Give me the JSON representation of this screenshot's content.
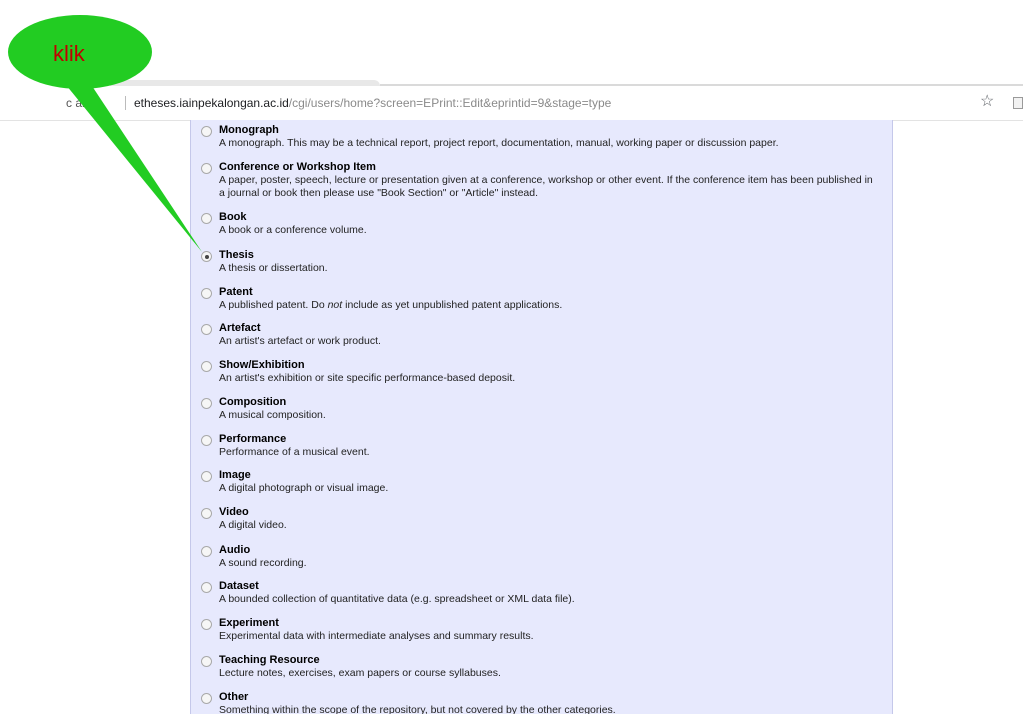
{
  "browser": {
    "url_prefix": "c ar",
    "url_host": "etheses.iainpekalongan.ac.id",
    "url_path": "/cgi/users/home?screen=EPrint::Edit&eprintid=9&stage=type"
  },
  "annotation": {
    "label": "klik",
    "color": "#22cc22"
  },
  "options": [
    {
      "title": "Monograph",
      "desc": "A monograph. This may be a technical report, project report, documentation, manual, working paper or discussion paper.",
      "checked": false
    },
    {
      "title": "Conference or Workshop Item",
      "desc": "A paper, poster, speech, lecture or presentation given at a conference, workshop or other event. If the conference item has been published in a journal or book then please use \"Book Section\" or \"Article\" instead.",
      "checked": false
    },
    {
      "title": "Book",
      "desc": "A book or a conference volume.",
      "checked": false
    },
    {
      "title": "Thesis",
      "desc": "A thesis or dissertation.",
      "checked": true
    },
    {
      "title": "Patent",
      "desc_before": "A published patent. Do ",
      "desc_em": "not",
      "desc_after": " include as yet unpublished patent applications.",
      "checked": false
    },
    {
      "title": "Artefact",
      "desc": "An artist's artefact or work product.",
      "checked": false
    },
    {
      "title": "Show/Exhibition",
      "desc": "An artist's exhibition or site specific performance-based deposit.",
      "checked": false
    },
    {
      "title": "Composition",
      "desc": "A musical composition.",
      "checked": false
    },
    {
      "title": "Performance",
      "desc": "Performance of a musical event.",
      "checked": false
    },
    {
      "title": "Image",
      "desc": "A digital photograph or visual image.",
      "checked": false
    },
    {
      "title": "Video",
      "desc": "A digital video.",
      "checked": false
    },
    {
      "title": "Audio",
      "desc": "A sound recording.",
      "checked": false
    },
    {
      "title": "Dataset",
      "desc": "A bounded collection of quantitative data (e.g. spreadsheet or XML data file).",
      "checked": false
    },
    {
      "title": "Experiment",
      "desc": "Experimental data with intermediate analyses and summary results.",
      "checked": false
    },
    {
      "title": "Teaching Resource",
      "desc": "Lecture notes, exercises, exam papers or course syllabuses.",
      "checked": false
    },
    {
      "title": "Other",
      "desc": "Something within the scope of the repository, but not covered by the other categories.",
      "checked": false
    }
  ]
}
